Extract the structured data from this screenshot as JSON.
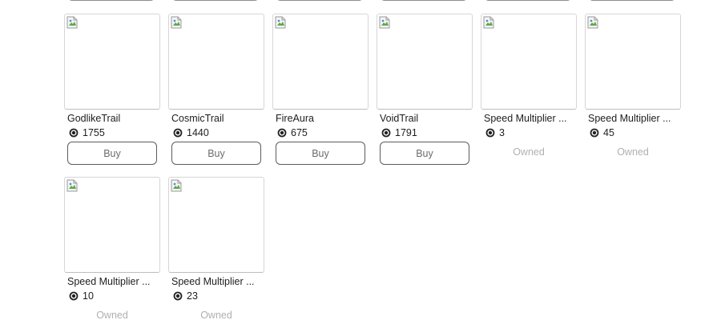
{
  "shop": {
    "coin_icon": "coin-icon",
    "placeholder_icon": "broken-image-icon",
    "items": [
      {
        "name": "GodlikeTrail",
        "price": "1755",
        "status": "buy",
        "action_label": "Buy"
      },
      {
        "name": "CosmicTrail",
        "price": "1440",
        "status": "buy",
        "action_label": "Buy"
      },
      {
        "name": "FireAura",
        "price": "675",
        "status": "buy",
        "action_label": "Buy"
      },
      {
        "name": "VoidTrail",
        "price": "1791",
        "status": "buy",
        "action_label": "Buy"
      },
      {
        "name": "Speed Multiplier ...",
        "price": "3",
        "status": "owned",
        "action_label": "Owned"
      },
      {
        "name": "Speed Multiplier ...",
        "price": "45",
        "status": "owned",
        "action_label": "Owned"
      },
      {
        "name": "Speed Multiplier ...",
        "price": "10",
        "status": "owned",
        "action_label": "Owned"
      },
      {
        "name": "Speed Multiplier ...",
        "price": "23",
        "status": "owned",
        "action_label": "Owned"
      }
    ]
  }
}
